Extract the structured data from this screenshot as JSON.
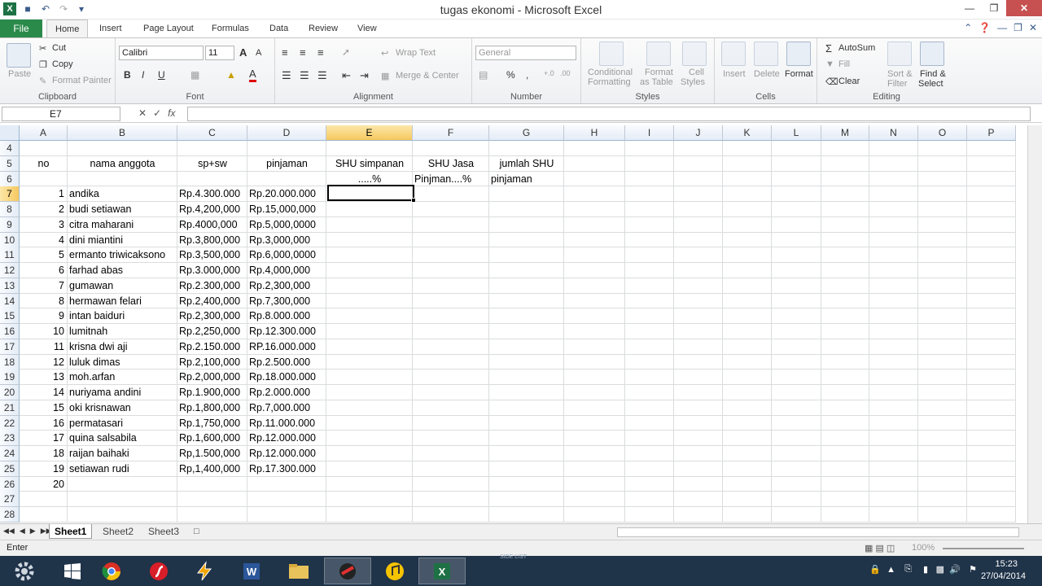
{
  "window": {
    "title": "tugas ekonomi - Microsoft Excel"
  },
  "ribbon_tabs": [
    "File",
    "Home",
    "Insert",
    "Page Layout",
    "Formulas",
    "Data",
    "Review",
    "View"
  ],
  "clipboard": {
    "paste": "Paste",
    "cut": "Cut",
    "copy": "Copy",
    "format_painter": "Format Painter",
    "label": "Clipboard"
  },
  "font": {
    "name": "Calibri",
    "size": "11",
    "label": "Font"
  },
  "alignment": {
    "wrap_text": "Wrap Text",
    "merge_center": "Merge & Center",
    "label": "Alignment"
  },
  "number": {
    "format": "General",
    "label": "Number"
  },
  "styles": {
    "conditional": "Conditional",
    "formatting": "Formatting",
    "format_as": "Format",
    "as_table": "as Table",
    "cell": "Cell",
    "cell_styles": "Styles",
    "label": "Styles"
  },
  "cells": {
    "insert": "Insert",
    "delete": "Delete",
    "format": "Format",
    "label": "Cells"
  },
  "editing": {
    "autosum": "AutoSum",
    "fill": "Fill",
    "clear": "Clear",
    "sort": "Sort &",
    "filter": "Filter",
    "find": "Find &",
    "select": "Select",
    "label": "Editing"
  },
  "formula_bar": {
    "name_box": "E7",
    "fx": "fx",
    "formula": ""
  },
  "columns": [
    "A",
    "B",
    "C",
    "D",
    "E",
    "F",
    "G",
    "H",
    "I",
    "J",
    "K",
    "L",
    "M",
    "N",
    "O",
    "P"
  ],
  "rows": [
    "4",
    "5",
    "6",
    "7",
    "8",
    "9",
    "10",
    "11",
    "12",
    "13",
    "14",
    "15",
    "16",
    "17",
    "18",
    "19",
    "20",
    "21",
    "22",
    "23",
    "24",
    "25",
    "26",
    "27",
    "28"
  ],
  "headers": {
    "no": "no",
    "nama": "nama anggota",
    "spsw": "sp+sw",
    "pinjaman": "pinjaman",
    "shu_simpanan": "SHU simpanan",
    "shu_simpanan_pct": ".....%",
    "shu_jasa": "SHU Jasa",
    "shu_jasa_pct": "Pinjman....%",
    "jumlah_shu": "jumlah SHU",
    "jumlah_shu_sub": "pinjaman"
  },
  "members": [
    {
      "no": "1",
      "nama": "andika",
      "spsw": "Rp.4.300.000",
      "pinjaman": "Rp.20.000.000"
    },
    {
      "no": "2",
      "nama": "budi setiawan",
      "spsw": "Rp.4,200,000",
      "pinjaman": "Rp.15,000,000"
    },
    {
      "no": "3",
      "nama": "citra maharani",
      "spsw": "Rp.4000,000",
      "pinjaman": "Rp.5,000,0000"
    },
    {
      "no": "4",
      "nama": "dini miantini",
      "spsw": "Rp.3,800,000",
      "pinjaman": "Rp.3,000,000"
    },
    {
      "no": "5",
      "nama": "ermanto triwicaksono",
      "spsw": "Rp.3,500,000",
      "pinjaman": "Rp.6,000,0000"
    },
    {
      "no": "6",
      "nama": "farhad abas",
      "spsw": "Rp.3.000,000",
      "pinjaman": "Rp.4,000,000"
    },
    {
      "no": "7",
      "nama": "gumawan",
      "spsw": "Rp.2.300,000",
      "pinjaman": "Rp.2,300,000"
    },
    {
      "no": "8",
      "nama": "hermawan felari",
      "spsw": "Rp.2,400,000",
      "pinjaman": "Rp.7,300,000"
    },
    {
      "no": "9",
      "nama": "intan baiduri",
      "spsw": "Rp.2,300,000",
      "pinjaman": "Rp.8.000.000"
    },
    {
      "no": "10",
      "nama": "lumitnah",
      "spsw": "Rp.2,250,000",
      "pinjaman": "Rp.12.300.000"
    },
    {
      "no": "11",
      "nama": "krisna dwi aji",
      "spsw": "Rp.2.150.000",
      "pinjaman": "RP.16.000.000"
    },
    {
      "no": "12",
      "nama": "luluk dimas",
      "spsw": "Rp.2,100,000",
      "pinjaman": "Rp.2.500.000"
    },
    {
      "no": "13",
      "nama": "moh.arfan",
      "spsw": "Rp.2,000,000",
      "pinjaman": "Rp.18.000.000"
    },
    {
      "no": "14",
      "nama": "nuriyama andini",
      "spsw": "Rp.1.900,000",
      "pinjaman": "Rp.2.000.000"
    },
    {
      "no": "15",
      "nama": "oki krisnawan",
      "spsw": "Rp.1,800,000",
      "pinjaman": "Rp.7,000.000"
    },
    {
      "no": "16",
      "nama": "permatasari",
      "spsw": "Rp.1,750,000",
      "pinjaman": "Rp.11.000.000"
    },
    {
      "no": "17",
      "nama": "quina salsabila",
      "spsw": "Rp.1,600,000",
      "pinjaman": "Rp.12.000.000"
    },
    {
      "no": "18",
      "nama": "raijan baihaki",
      "spsw": "Rp,1.500,000",
      "pinjaman": "Rp.12.000.000"
    },
    {
      "no": "19",
      "nama": "setiawan rudi",
      "spsw": "Rp,1,400,000",
      "pinjaman": "Rp.17.300.000"
    }
  ],
  "row26_no": "20",
  "sheets": [
    "Sheet1",
    "Sheet2",
    "Sheet3"
  ],
  "status": {
    "mode": "Enter",
    "zoom": "100%"
  },
  "taskbar": {
    "time": "15:23",
    "date": "27/04/2014",
    "side_list": "SIDE LIST"
  }
}
